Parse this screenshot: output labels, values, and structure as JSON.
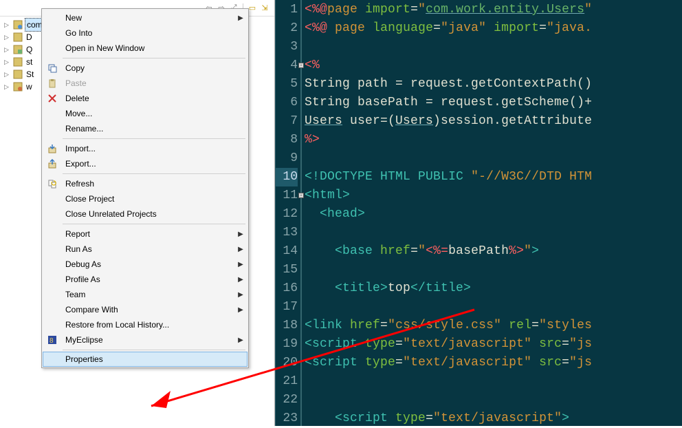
{
  "toolbar": {
    "icons": [
      "back",
      "forward",
      "link",
      "minimize",
      "menu"
    ]
  },
  "tree": {
    "items": [
      {
        "label": "commy",
        "selected": true,
        "icon": "project-web"
      },
      {
        "label": "D",
        "selected": false,
        "icon": "project"
      },
      {
        "label": "Q",
        "selected": false,
        "icon": "project-q"
      },
      {
        "label": "st",
        "selected": false,
        "icon": "project"
      },
      {
        "label": "St",
        "selected": false,
        "icon": "project"
      },
      {
        "label": "w",
        "selected": false,
        "icon": "project-w"
      }
    ]
  },
  "menu": {
    "items": [
      {
        "label": "New",
        "submenu": true,
        "icon": ""
      },
      {
        "label": "Go Into",
        "submenu": false,
        "icon": ""
      },
      {
        "label": "Open in New Window",
        "submenu": false,
        "icon": ""
      },
      {
        "sep": true
      },
      {
        "label": "Copy",
        "submenu": false,
        "icon": "copy"
      },
      {
        "label": "Paste",
        "submenu": false,
        "icon": "paste",
        "disabled": true
      },
      {
        "label": "Delete",
        "submenu": false,
        "icon": "delete"
      },
      {
        "label": "Move...",
        "submenu": false,
        "icon": ""
      },
      {
        "label": "Rename...",
        "submenu": false,
        "icon": ""
      },
      {
        "sep": true
      },
      {
        "label": "Import...",
        "submenu": false,
        "icon": "import"
      },
      {
        "label": "Export...",
        "submenu": false,
        "icon": "export"
      },
      {
        "sep": true
      },
      {
        "label": "Refresh",
        "submenu": false,
        "icon": "refresh"
      },
      {
        "label": "Close Project",
        "submenu": false,
        "icon": ""
      },
      {
        "label": "Close Unrelated Projects",
        "submenu": false,
        "icon": ""
      },
      {
        "sep": true
      },
      {
        "label": "Report",
        "submenu": true,
        "icon": ""
      },
      {
        "label": "Run As",
        "submenu": true,
        "icon": ""
      },
      {
        "label": "Debug As",
        "submenu": true,
        "icon": ""
      },
      {
        "label": "Profile As",
        "submenu": true,
        "icon": ""
      },
      {
        "label": "Team",
        "submenu": true,
        "icon": ""
      },
      {
        "label": "Compare With",
        "submenu": true,
        "icon": ""
      },
      {
        "label": "Restore from Local History...",
        "submenu": false,
        "icon": ""
      },
      {
        "label": "MyEclipse",
        "submenu": true,
        "icon": "myeclipse"
      },
      {
        "sep": true
      },
      {
        "label": "Properties",
        "submenu": false,
        "icon": "",
        "hover": true
      }
    ]
  },
  "editor": {
    "current_line": 10,
    "fold_lines": [
      4,
      11
    ],
    "lines": [
      "<%@page import=\"com.work.entity.Users\"",
      "<%@ page language=\"java\" import=\"java.",
      "",
      "<%",
      "String path = request.getContextPath()",
      "String basePath = request.getScheme()+",
      "Users user=(Users)session.getAttribute",
      "%>",
      "",
      "<!DOCTYPE HTML PUBLIC \"-//W3C//DTD HTM",
      "<html>",
      "  <head>",
      "",
      "    <base href=\"<%=basePath%>\">",
      "",
      "    <title>top</title>",
      "",
      "<link href=\"css/style.css\" rel=\"styles",
      "<script type=\"text/javascript\" src=\"js",
      "<script type=\"text/javascript\" src=\"js",
      "",
      "",
      "    <script type=\"text/javascript\">"
    ]
  }
}
